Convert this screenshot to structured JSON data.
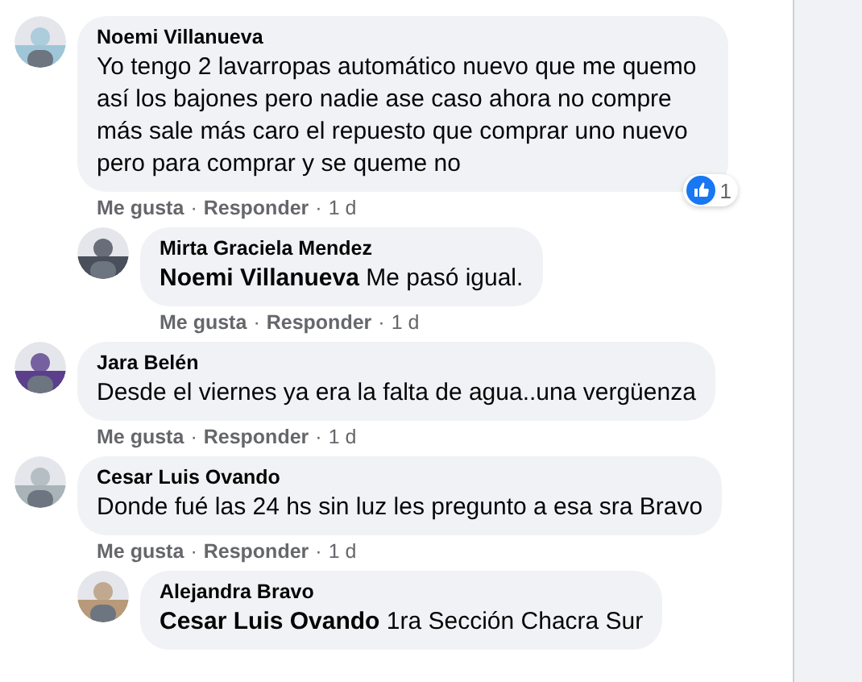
{
  "separator": "·",
  "comments": [
    {
      "author": "Noemi Villanueva",
      "text": "Yo tengo 2 lavarropas automático nuevo que me quemo así los bajones pero nadie ase caso ahora no compre más sale más caro el repuesto que comprar uno nuevo pero para comprar y se queme no",
      "reaction_count": "1",
      "actions": [
        "Me gusta",
        "Responder"
      ],
      "time": "1 d",
      "replies": [
        {
          "author": "Mirta Graciela Mendez",
          "mention": "Noemi Villanueva",
          "text": "Me pasó igual.",
          "actions": [
            "Me gusta",
            "Responder"
          ],
          "time": "1 d"
        }
      ]
    },
    {
      "author": "Jara Belén",
      "text": "Desde el viernes ya era la falta de agua..una vergüenza",
      "actions": [
        "Me gusta",
        "Responder"
      ],
      "time": "1 d"
    },
    {
      "author": "Cesar Luis Ovando",
      "text": "Donde fué las 24 hs sin luz les pregunto a esa sra Bravo",
      "actions": [
        "Me gusta",
        "Responder"
      ],
      "time": "1 d",
      "replies": [
        {
          "author": "Alejandra Bravo",
          "mention": "Cesar Luis Ovando",
          "text": "1ra Sección Chacra Sur"
        }
      ]
    }
  ]
}
